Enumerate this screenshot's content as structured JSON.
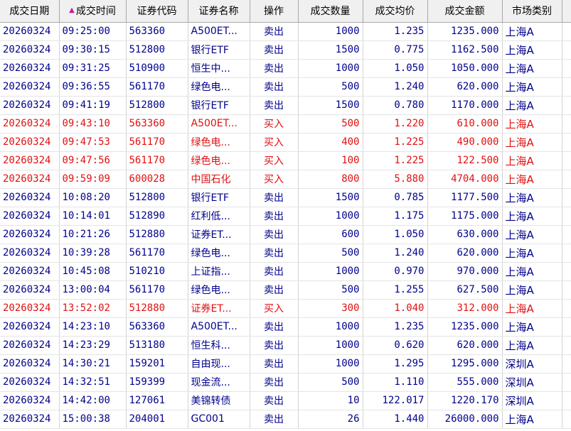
{
  "columns": [
    "成交日期",
    "成交时间",
    "证券代码",
    "证券名称",
    "操作",
    "成交数量",
    "成交均价",
    "成交金额",
    "市场类别"
  ],
  "sort": {
    "column": "成交时间",
    "direction": "ascending",
    "icon": "sort-ascending-icon",
    "icon_color": "#c0209a"
  },
  "colors": {
    "sell": "#00008b",
    "buy": "#e01010",
    "header_bg": "#f0f0f0"
  },
  "rows": [
    {
      "date": "20260324",
      "time": "09:25:00",
      "code": "563360",
      "name": "A500ET...",
      "op": "卖出",
      "qty": "1000",
      "price": "1.235",
      "amount": "1235.000",
      "market": "上海A",
      "side": "sell"
    },
    {
      "date": "20260324",
      "time": "09:30:15",
      "code": "512800",
      "name": "银行ETF",
      "op": "卖出",
      "qty": "1500",
      "price": "0.775",
      "amount": "1162.500",
      "market": "上海A",
      "side": "sell"
    },
    {
      "date": "20260324",
      "time": "09:31:25",
      "code": "510900",
      "name": "恒生中...",
      "op": "卖出",
      "qty": "1000",
      "price": "1.050",
      "amount": "1050.000",
      "market": "上海A",
      "side": "sell"
    },
    {
      "date": "20260324",
      "time": "09:36:55",
      "code": "561170",
      "name": "绿色电...",
      "op": "卖出",
      "qty": "500",
      "price": "1.240",
      "amount": "620.000",
      "market": "上海A",
      "side": "sell"
    },
    {
      "date": "20260324",
      "time": "09:41:19",
      "code": "512800",
      "name": "银行ETF",
      "op": "卖出",
      "qty": "1500",
      "price": "0.780",
      "amount": "1170.000",
      "market": "上海A",
      "side": "sell"
    },
    {
      "date": "20260324",
      "time": "09:43:10",
      "code": "563360",
      "name": "A500ET...",
      "op": "买入",
      "qty": "500",
      "price": "1.220",
      "amount": "610.000",
      "market": "上海A",
      "side": "buy"
    },
    {
      "date": "20260324",
      "time": "09:47:53",
      "code": "561170",
      "name": "绿色电...",
      "op": "买入",
      "qty": "400",
      "price": "1.225",
      "amount": "490.000",
      "market": "上海A",
      "side": "buy"
    },
    {
      "date": "20260324",
      "time": "09:47:56",
      "code": "561170",
      "name": "绿色电...",
      "op": "买入",
      "qty": "100",
      "price": "1.225",
      "amount": "122.500",
      "market": "上海A",
      "side": "buy"
    },
    {
      "date": "20260324",
      "time": "09:59:09",
      "code": "600028",
      "name": "中国石化",
      "op": "买入",
      "qty": "800",
      "price": "5.880",
      "amount": "4704.000",
      "market": "上海A",
      "side": "buy"
    },
    {
      "date": "20260324",
      "time": "10:08:20",
      "code": "512800",
      "name": "银行ETF",
      "op": "卖出",
      "qty": "1500",
      "price": "0.785",
      "amount": "1177.500",
      "market": "上海A",
      "side": "sell"
    },
    {
      "date": "20260324",
      "time": "10:14:01",
      "code": "512890",
      "name": "红利低...",
      "op": "卖出",
      "qty": "1000",
      "price": "1.175",
      "amount": "1175.000",
      "market": "上海A",
      "side": "sell"
    },
    {
      "date": "20260324",
      "time": "10:21:26",
      "code": "512880",
      "name": "证券ET...",
      "op": "卖出",
      "qty": "600",
      "price": "1.050",
      "amount": "630.000",
      "market": "上海A",
      "side": "sell"
    },
    {
      "date": "20260324",
      "time": "10:39:28",
      "code": "561170",
      "name": "绿色电...",
      "op": "卖出",
      "qty": "500",
      "price": "1.240",
      "amount": "620.000",
      "market": "上海A",
      "side": "sell"
    },
    {
      "date": "20260324",
      "time": "10:45:08",
      "code": "510210",
      "name": "上证指...",
      "op": "卖出",
      "qty": "1000",
      "price": "0.970",
      "amount": "970.000",
      "market": "上海A",
      "side": "sell"
    },
    {
      "date": "20260324",
      "time": "13:00:04",
      "code": "561170",
      "name": "绿色电...",
      "op": "卖出",
      "qty": "500",
      "price": "1.255",
      "amount": "627.500",
      "market": "上海A",
      "side": "sell"
    },
    {
      "date": "20260324",
      "time": "13:52:02",
      "code": "512880",
      "name": "证券ET...",
      "op": "买入",
      "qty": "300",
      "price": "1.040",
      "amount": "312.000",
      "market": "上海A",
      "side": "buy"
    },
    {
      "date": "20260324",
      "time": "14:23:10",
      "code": "563360",
      "name": "A500ET...",
      "op": "卖出",
      "qty": "1000",
      "price": "1.235",
      "amount": "1235.000",
      "market": "上海A",
      "side": "sell"
    },
    {
      "date": "20260324",
      "time": "14:23:29",
      "code": "513180",
      "name": "恒生科...",
      "op": "卖出",
      "qty": "1000",
      "price": "0.620",
      "amount": "620.000",
      "market": "上海A",
      "side": "sell"
    },
    {
      "date": "20260324",
      "time": "14:30:21",
      "code": "159201",
      "name": "自由现...",
      "op": "卖出",
      "qty": "1000",
      "price": "1.295",
      "amount": "1295.000",
      "market": "深圳A",
      "side": "sell"
    },
    {
      "date": "20260324",
      "time": "14:32:51",
      "code": "159399",
      "name": "现金流...",
      "op": "卖出",
      "qty": "500",
      "price": "1.110",
      "amount": "555.000",
      "market": "深圳A",
      "side": "sell"
    },
    {
      "date": "20260324",
      "time": "14:42:00",
      "code": "127061",
      "name": "美锦转债",
      "op": "卖出",
      "qty": "10",
      "price": "122.017",
      "amount": "1220.170",
      "market": "深圳A",
      "side": "sell"
    },
    {
      "date": "20260324",
      "time": "15:00:38",
      "code": "204001",
      "name": "GC001",
      "op": "卖出",
      "qty": "26",
      "price": "1.440",
      "amount": "26000.000",
      "market": "上海A",
      "side": "sell"
    }
  ]
}
